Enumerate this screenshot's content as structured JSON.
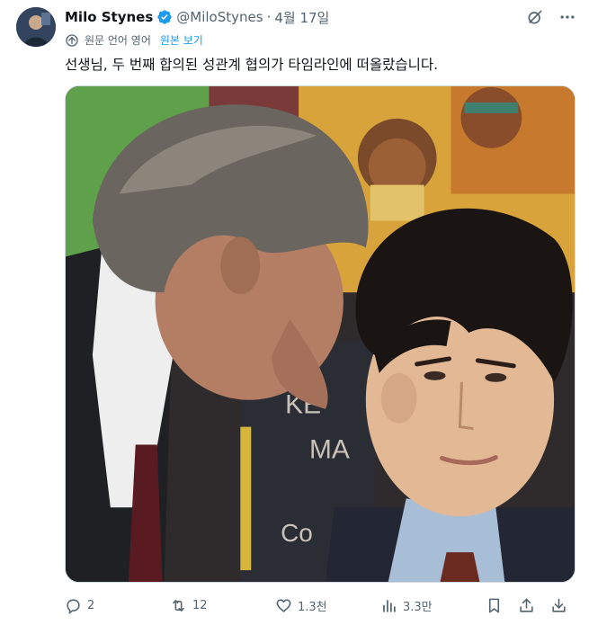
{
  "author": {
    "name": "Milo Stynes",
    "handle": "@MiloStynes",
    "separator": "·",
    "date": "4월 17일",
    "verified": true,
    "verified_color": "#1d9bf0"
  },
  "translation": {
    "label": "원문 언어 영어",
    "link": "원본 보기"
  },
  "tweet": {
    "text": "선생님, 두 번째 합의된 성관계 협의가 타임라인에 떠올랐습니다."
  },
  "top_icons": [
    "grok-icon",
    "more-icon"
  ],
  "actions": {
    "reply_count": "2",
    "repost_count": "12",
    "like_count": "1.3천",
    "views_count": "3.3만"
  },
  "colors": {
    "accent": "#1d9bf0",
    "text": "#0f1419",
    "secondary": "#536471"
  }
}
